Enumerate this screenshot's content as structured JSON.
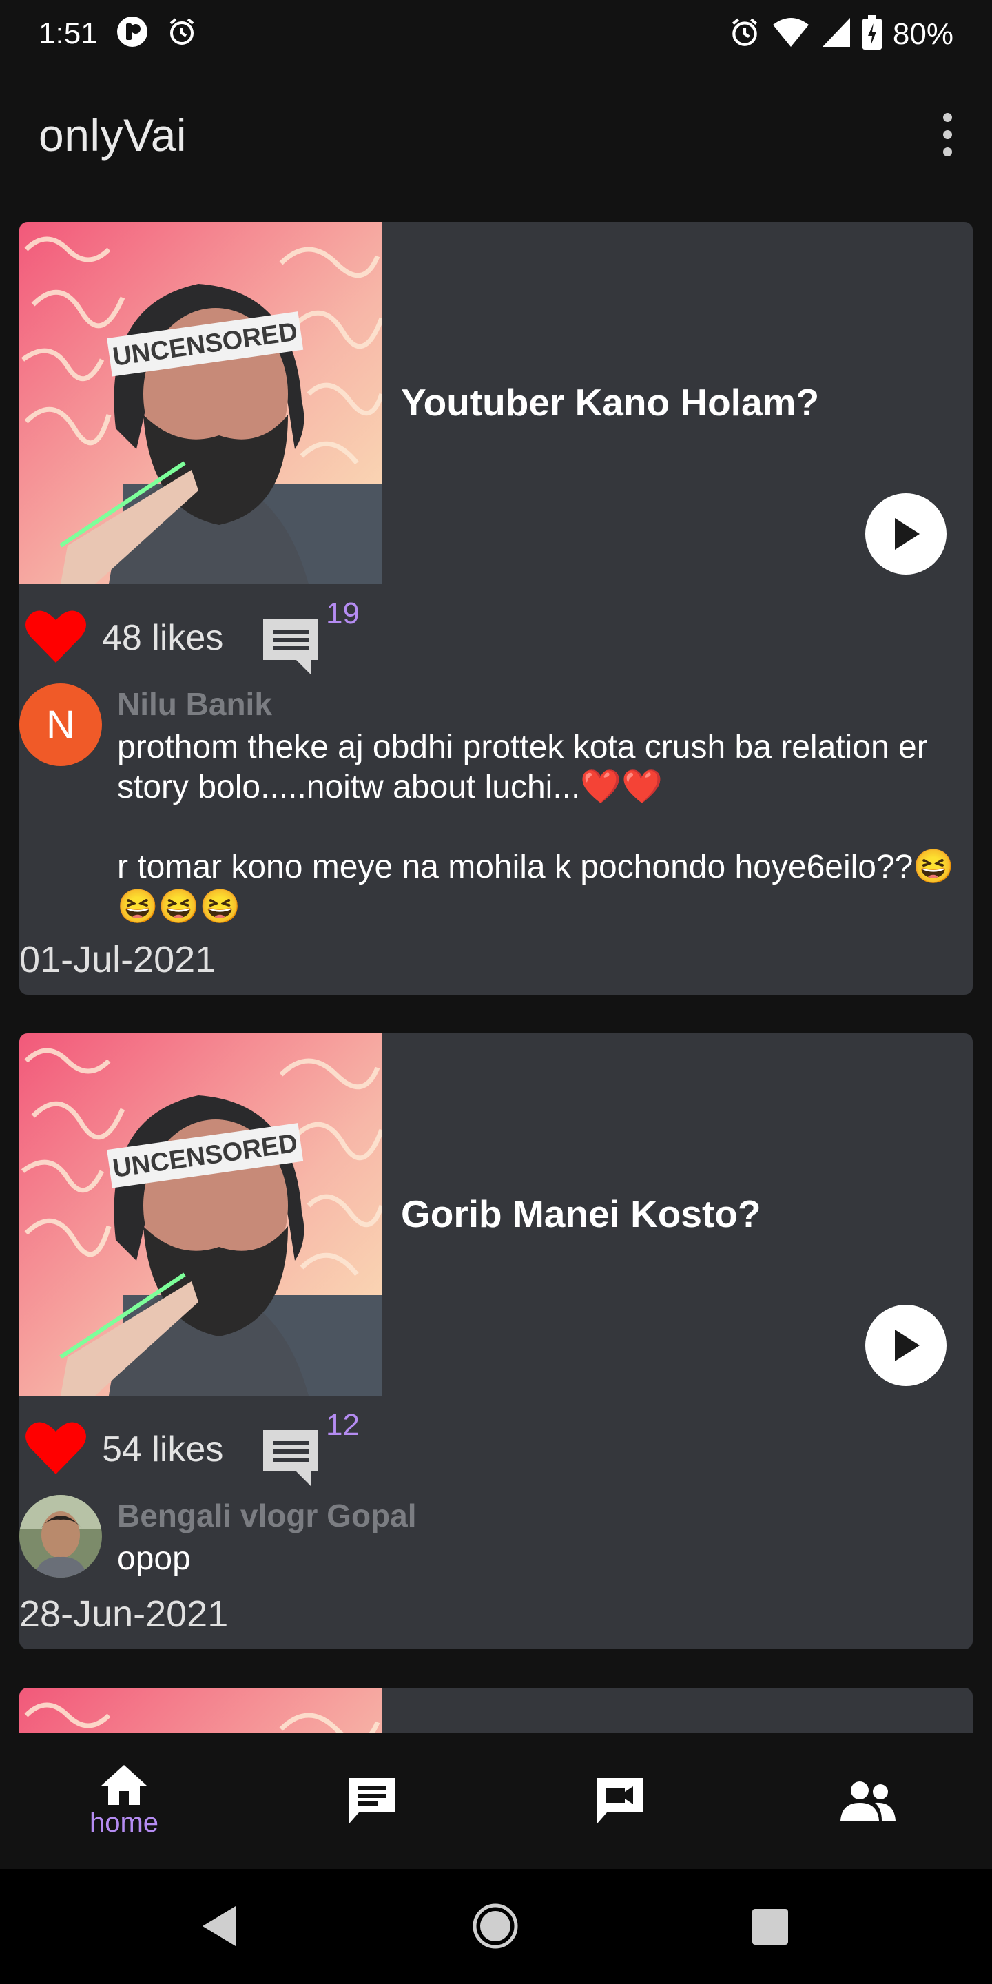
{
  "status_bar": {
    "time": "1:51",
    "battery": "80%",
    "left_icons": [
      "app-notification-icon",
      "alarm-icon"
    ],
    "right_icons": [
      "alarm-icon",
      "wifi-icon",
      "signal-icon",
      "battery-charging-icon"
    ]
  },
  "app_bar": {
    "title": "onlyVai",
    "menu_icon": "more-vert-icon"
  },
  "posts": [
    {
      "title": "Youtuber Kano Holam?",
      "thumbnail_text": "UNCENSORED",
      "likes": "48 likes",
      "comments_count": "19",
      "comment": {
        "author": "Nilu Banik",
        "avatar_letter": "N",
        "text": "prothom theke aj obdhi prottek kota crush ba relation er story bolo.....noitw about luchi...❤️❤️\n\nr tomar kono meye na mohila k pochondo hoye6eilo??😆😆😆😆"
      },
      "date": "01-Jul-2021"
    },
    {
      "title": "Gorib Manei Kosto?",
      "thumbnail_text": "UNCENSORED",
      "likes": "54 likes",
      "comments_count": "12",
      "comment": {
        "author": "Bengali vlogr Gopal",
        "text": "opop"
      },
      "date": "28-Jun-2021"
    }
  ],
  "bottom_nav": {
    "items": [
      {
        "icon": "home-icon",
        "label": "home",
        "active": true
      },
      {
        "icon": "chat-icon",
        "label": "",
        "active": false
      },
      {
        "icon": "video-chat-icon",
        "label": "",
        "active": false
      },
      {
        "icon": "people-icon",
        "label": "",
        "active": false
      }
    ]
  },
  "system_nav": {
    "icons": [
      "back-icon",
      "home-circle-icon",
      "recents-icon"
    ]
  },
  "colors": {
    "background": "#121212",
    "card": "#35373c",
    "accent": "#b58cf2",
    "heart": "#ff0000",
    "avatar_n": "#f05a28"
  }
}
